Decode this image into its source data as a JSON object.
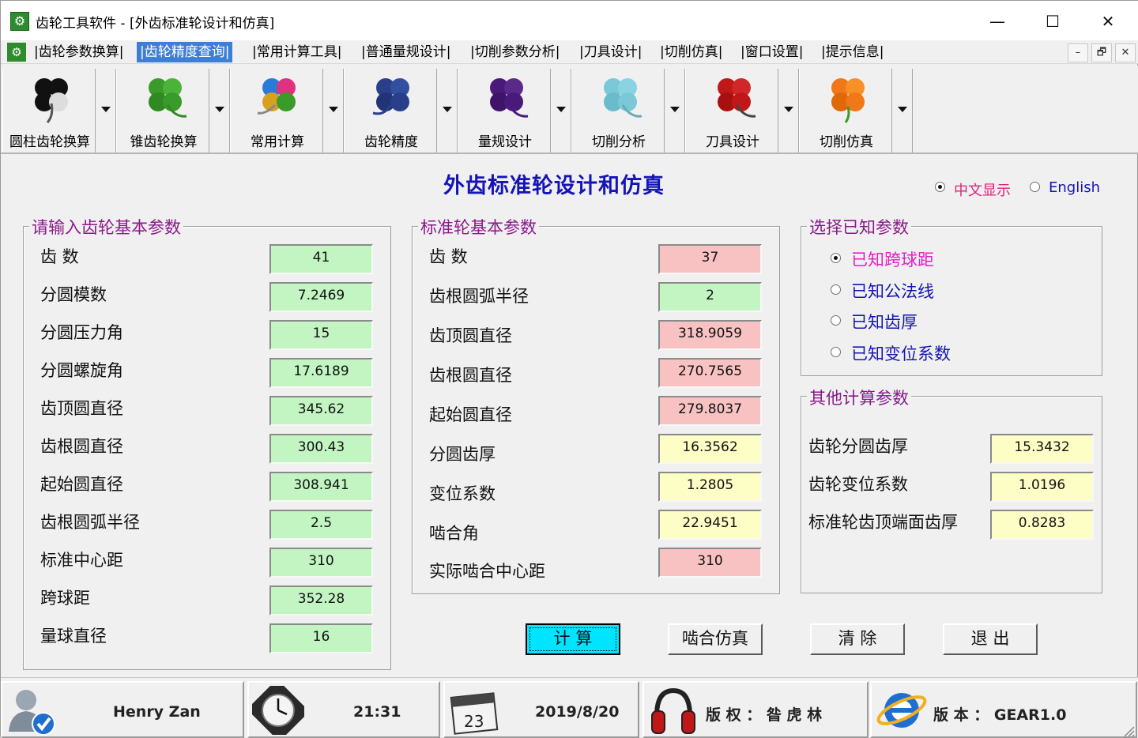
{
  "window": {
    "title": "齿轮工具软件 - [外齿标准轮设计和仿真]",
    "controls": {
      "minimize": "—",
      "maximize": "☐",
      "close": "✕"
    }
  },
  "menu": {
    "items": [
      "|齿轮参数换算|",
      "|齿轮精度查询|",
      "|常用计算工具|",
      "|普通量规设计|",
      "|切削参数分析|",
      "|刀具设计|",
      "|切削仿真|",
      "|窗口设置|",
      "|提示信息|"
    ],
    "active_index": 1,
    "mdi": {
      "minimize": "–",
      "restore": "🗗",
      "close": "✕"
    }
  },
  "toolbar": {
    "items": [
      {
        "label": "圆柱齿轮换算",
        "icon": "clover-black-icon",
        "color": "#111111"
      },
      {
        "label": "锥齿轮换算",
        "icon": "clover-green-icon",
        "color": "#3a9a2a"
      },
      {
        "label": "常用计算",
        "icon": "clover-colorful-icon",
        "color": "#e03080"
      },
      {
        "label": "齿轮精度",
        "icon": "clover-navy-icon",
        "color": "#2a3f8a"
      },
      {
        "label": "量规设计",
        "icon": "clover-purple-icon",
        "color": "#4a1a7a"
      },
      {
        "label": "切削分析",
        "icon": "clover-lightblue-icon",
        "color": "#7ac8d8"
      },
      {
        "label": "刀具设计",
        "icon": "clover-red-icon",
        "color": "#c01818"
      },
      {
        "label": "切削仿真",
        "icon": "clover-orange-icon",
        "color": "#f07818"
      }
    ]
  },
  "main": {
    "heading": "外齿标准轮设计和仿真",
    "language": {
      "chinese": "中文显示",
      "english": "English",
      "selected": "chinese"
    },
    "input_group": {
      "title": "请输入齿轮基本参数",
      "rows": [
        {
          "label": "齿  数",
          "value": "41"
        },
        {
          "label": "分圆模数",
          "value": "7.2469"
        },
        {
          "label": "分圆压力角",
          "value": "15"
        },
        {
          "label": "分圆螺旋角",
          "value": "17.6189"
        },
        {
          "label": "齿顶圆直径",
          "value": "345.62"
        },
        {
          "label": "齿根圆直径",
          "value": "300.43"
        },
        {
          "label": "起始圆直径",
          "value": "308.941"
        },
        {
          "label": "齿根圆弧半径",
          "value": "2.5"
        },
        {
          "label": "标准中心距",
          "value": "310"
        },
        {
          "label": "跨球距",
          "value": "352.28"
        },
        {
          "label": "量球直径",
          "value": "16"
        }
      ]
    },
    "standard_group": {
      "title": "标准轮基本参数",
      "rows": [
        {
          "label": "齿  数",
          "value": "37",
          "color": "pink"
        },
        {
          "label": "齿根圆弧半径",
          "value": "2",
          "color": "green"
        },
        {
          "label": "齿顶圆直径",
          "value": "318.9059",
          "color": "pink"
        },
        {
          "label": "齿根圆直径",
          "value": "270.7565",
          "color": "pink"
        },
        {
          "label": "起始圆直径",
          "value": "279.8037",
          "color": "pink"
        },
        {
          "label": "分圆齿厚",
          "value": "16.3562",
          "color": "yellow"
        },
        {
          "label": "变位系数",
          "value": "1.2805",
          "color": "yellow"
        },
        {
          "label": "啮合角",
          "value": "22.9451",
          "color": "yellow"
        },
        {
          "label": "实际啮合中心距",
          "value": "310",
          "color": "pink"
        }
      ]
    },
    "known_group": {
      "title": "选择已知参数",
      "options": [
        "已知跨球距",
        "已知公法线",
        "已知齿厚",
        "已知变位系数"
      ],
      "selected_index": 0
    },
    "other_group": {
      "title": "其他计算参数",
      "rows": [
        {
          "label": "齿轮分圆齿厚",
          "value": "15.3432"
        },
        {
          "label": "齿轮变位系数",
          "value": "1.0196"
        },
        {
          "label": "标准轮齿顶端面齿厚",
          "value": "0.8283"
        }
      ]
    },
    "buttons": {
      "calculate": "计  算",
      "mesh_sim": "啮合仿真",
      "clear": "清  除",
      "exit": "退  出"
    }
  },
  "status": {
    "user": "Henry Zan",
    "time": "21:31",
    "calendar_day": "23",
    "date": "2019/8/20",
    "copyright": "版 权 ：  昝 虎 林",
    "version": "版 本 ：  GEAR1.0"
  }
}
